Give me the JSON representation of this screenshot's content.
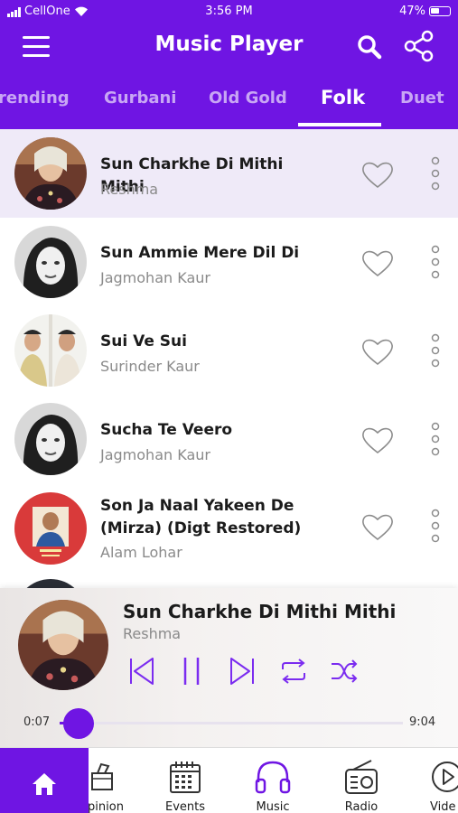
{
  "status_bar": {
    "carrier": "CellOne",
    "time": "3:56 PM",
    "battery": "47%"
  },
  "header": {
    "title": "Music Player"
  },
  "tabs": [
    {
      "label": "rending"
    },
    {
      "label": "Gurbani"
    },
    {
      "label": "Old Gold"
    },
    {
      "label": "Folk",
      "active": true
    },
    {
      "label": "Duet"
    }
  ],
  "songs": [
    {
      "title": "Sun Charkhe Di Mithi Mithi",
      "artist": "Reshma",
      "active": true
    },
    {
      "title": "Sun Ammie Mere Dil Di",
      "artist": "Jagmohan Kaur"
    },
    {
      "title": "Sui Ve Sui",
      "artist": "Surinder Kaur"
    },
    {
      "title": "Sucha Te Veero",
      "artist": "Jagmohan Kaur"
    },
    {
      "title": "Son Ja Naal Yakeen De (Mirza) (Digt Restored)",
      "artist": "Alam Lohar"
    }
  ],
  "player": {
    "title": "Sun Charkhe Di Mithi Mithi",
    "artist": "Reshma",
    "current_time": "0:07",
    "total_time": "9:04",
    "progress_percent": 1.3
  },
  "bottom_nav": [
    {
      "label": "",
      "icon": "home-icon",
      "active": true
    },
    {
      "label": "pinion",
      "icon": "opinion-icon"
    },
    {
      "label": "Events",
      "icon": "calendar-icon"
    },
    {
      "label": "Music",
      "icon": "headphones-icon"
    },
    {
      "label": "Radio",
      "icon": "radio-icon"
    },
    {
      "label": "Vide",
      "icon": "video-icon"
    }
  ],
  "colors": {
    "accent": "#6f15e3",
    "active_row": "#efeaf8",
    "muted_text": "#8a8a8a"
  }
}
